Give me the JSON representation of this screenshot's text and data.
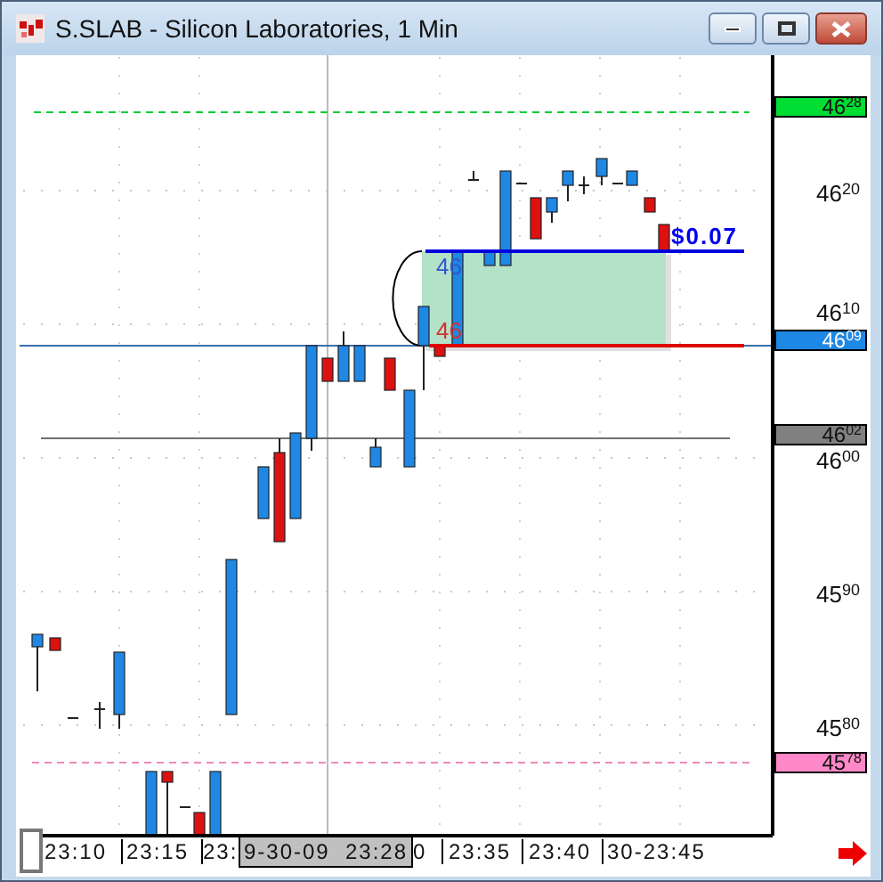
{
  "window": {
    "title": "S.SLAB - Silicon Laboratories, 1 Min"
  },
  "price_axis": {
    "labels": [
      "46$^{20}$",
      "46$^{10}$",
      "46$^{00}$",
      "45$^{90}$",
      "45$^{80}$"
    ]
  },
  "price_markers": [
    {
      "text": "46$^{28}$",
      "color": "#00dd33"
    },
    {
      "text": "46$^{09}$",
      "color": "#1e88e5"
    },
    {
      "text": "46$^{02}$",
      "color": "#808080"
    },
    {
      "text": "45$^{78}$",
      "color": "#ff88c8"
    }
  ],
  "chart_labels": [
    {
      "text": "46",
      "color": "#3355cc"
    },
    {
      "text": "46",
      "color": "#cc3333"
    },
    {
      "text": "$0.07",
      "color": "#0000ee"
    }
  ],
  "time_axis": {
    "labels": [
      "23:10",
      "23:15",
      "23:",
      "0",
      "23:35",
      "23:40",
      "30-23:45"
    ],
    "crosshair_label": "9-30-09  23:28"
  }
}
